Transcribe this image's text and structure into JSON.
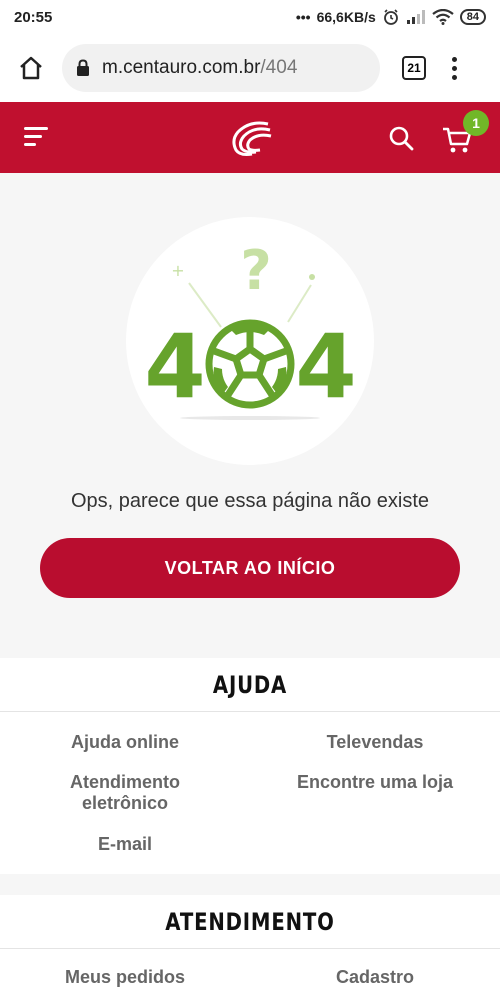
{
  "status_bar": {
    "time": "20:55",
    "network_speed": "66,6KB/s",
    "battery": "84"
  },
  "browser": {
    "url_domain": "m.centauro.com.br",
    "url_path": "/404",
    "tab_count": "21"
  },
  "header": {
    "cart_count": "1"
  },
  "error_page": {
    "code_left": "4",
    "code_right": "4",
    "question_mark": "?",
    "message": "Ops, parece que essa página não existe",
    "button_label": "VOLTAR AO INÍCIO"
  },
  "help_section": {
    "title": "AJUDA",
    "links": [
      "Ajuda online",
      "Televendas",
      "Atendimento eletrônico",
      "Encontre uma loja",
      "E-mail"
    ]
  },
  "service_section": {
    "title": "ATENDIMENTO",
    "links": [
      "Meus pedidos",
      "Cadastro"
    ]
  },
  "colors": {
    "brand_red": "#c0102f",
    "accent_green": "#71b728",
    "illustration_green": "#66a32c"
  }
}
